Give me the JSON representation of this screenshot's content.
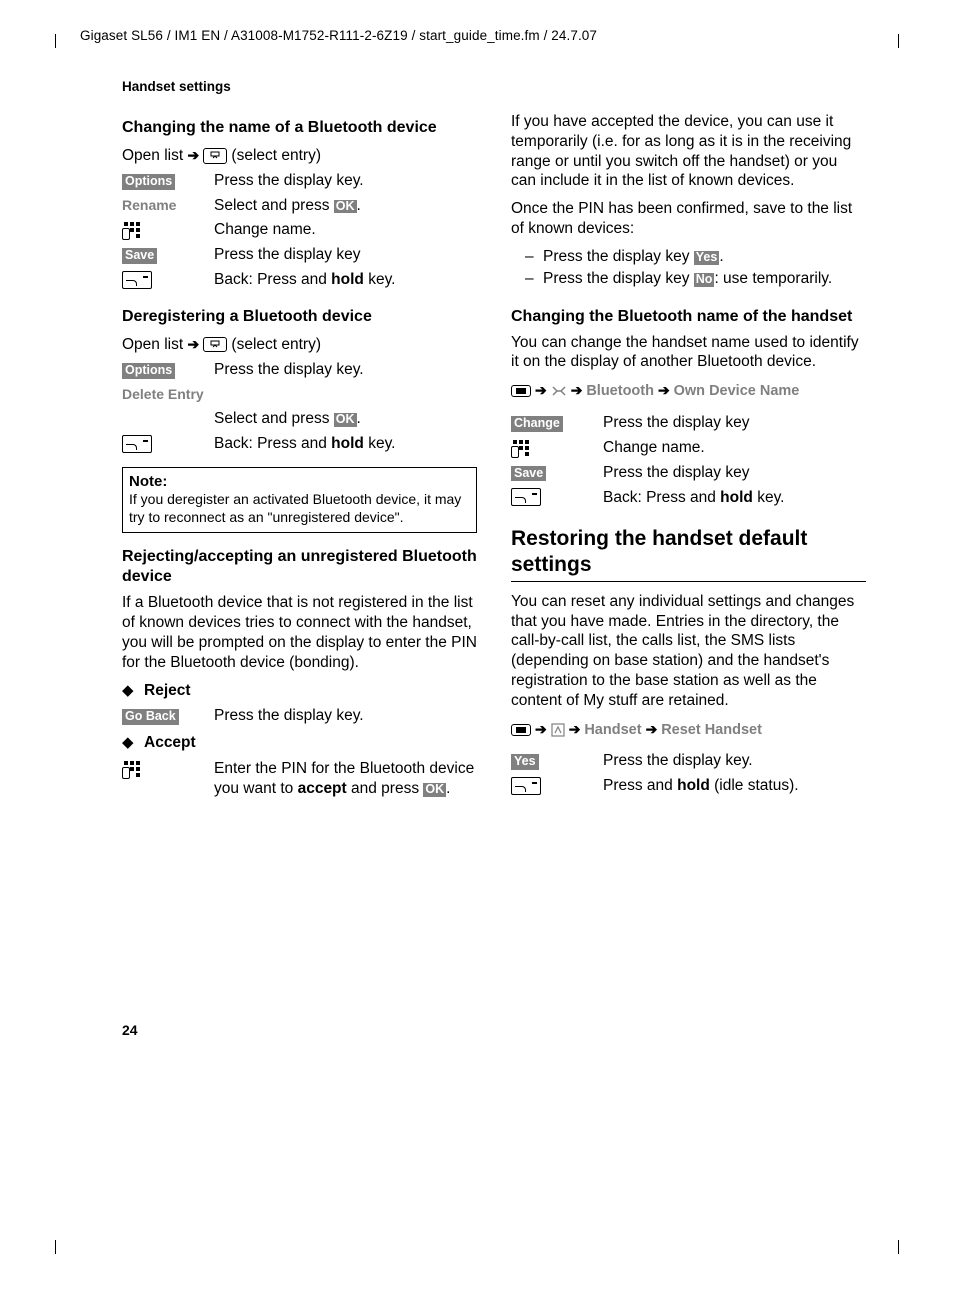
{
  "header": "Gigaset SL56 / IM1 EN / A31008-M1752-R111-2-6Z19 / start_guide_time.fm / 24.7.07",
  "running_head": "Handset settings",
  "page_number": "24",
  "left": {
    "sec1_title": "Changing the name of a Bluetooth device",
    "open_list": "Open list",
    "select_entry": "(select entry)",
    "options": "Options",
    "press_display_key": "Press the display key.",
    "rename": "Rename",
    "select_and_press": "Select and press ",
    "ok": "OK",
    "change_name": "Change name.",
    "save": "Save",
    "press_display_key2": "Press the display key",
    "back_press_hold": "Back: Press and ",
    "hold": "hold",
    "key_suffix": " key.",
    "sec2_title": "Deregistering a Bluetooth device",
    "delete_entry": "Delete Entry",
    "note_title": "Note:",
    "note_body": "If you deregister an activated Bluetooth device, it may try to reconnect as an \"unregistered device\".",
    "sec3_title": "Rejecting/accepting an unregistered Bluetooth device",
    "sec3_para": "If a Bluetooth device that is not registered in the list of known devices tries to connect with the handset, you will be prompted on the display to enter the PIN for the Bluetooth device (bonding).",
    "reject": "Reject",
    "go_back": "Go Back",
    "accept": "Accept",
    "accept_text1": "Enter the PIN for the Bluetooth device you want to ",
    "accept_bold": "accept",
    "accept_text2": " and press "
  },
  "right": {
    "para1": "If you have accepted the device, you can use it temporarily (i.e. for as long as it is in the receiving range or until you switch off the handset) or you can include it in the list of known devices.",
    "para2": "Once the PIN has been confirmed, save to the list of known devices:",
    "dash1_pre": "Press the display key ",
    "yes": "Yes",
    "dash2_pre": "Press the display key ",
    "no": "No",
    "dash2_post": ": use temporarily.",
    "sec4_title": "Changing the Bluetooth name of the handset",
    "sec4_para": "You can change the handset name used to identify it on the display of another Bluetooth device.",
    "nav_bluetooth": "Bluetooth",
    "nav_own_device": "Own Device Name",
    "change": "Change",
    "press_display_key": "Press the display key",
    "change_name": "Change name.",
    "save": "Save",
    "back_press": "Back: Press and ",
    "hold": "hold",
    "key_suffix": " key.",
    "h2": "Restoring the handset default settings",
    "restore_para": "You can reset any individual settings and changes that you have made. Entries in the directory, the call-by-call list, the calls list, the SMS lists (depending on base station) and the handset's registration to the base station as well as the content of My stuff are retained.",
    "nav_handset": "Handset",
    "nav_reset": "Reset Handset",
    "press_display_key_dot": "Press the display key.",
    "press_and": "Press and ",
    "idle_status": " (idle status)."
  }
}
